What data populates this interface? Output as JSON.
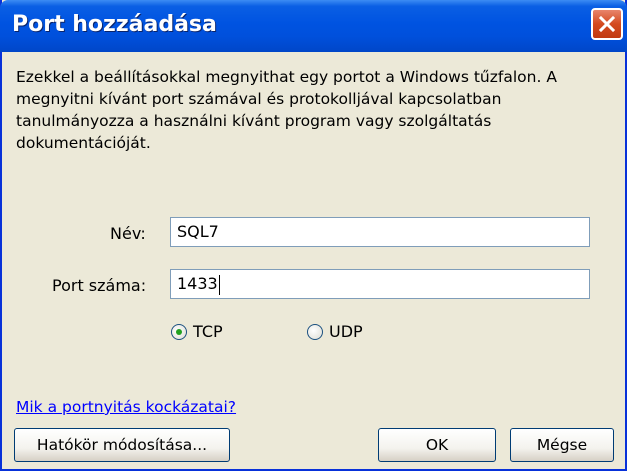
{
  "window": {
    "title": "Port hozzáadása"
  },
  "description": "Ezekkel a beállításokkal megnyithat egy portot a Windows tűzfalon. A megnyitni kívánt port számával és protokolljával kapcsolatban tanulmányozza a használni kívánt program vagy szolgáltatás dokumentációját.",
  "fields": {
    "name_label": "Név:",
    "name_value": "SQL7",
    "port_label": "Port száma:",
    "port_value": "1433"
  },
  "protocol": {
    "tcp_label": "TCP",
    "udp_label": "UDP",
    "selected": "TCP"
  },
  "link": {
    "risks": "Mik a portnyitás kockázatai?"
  },
  "buttons": {
    "scope": "Hatókör módosítása...",
    "ok": "OK",
    "cancel": "Mégse"
  },
  "icons": {
    "close": "close-icon",
    "radio_selected": "radio-selected-icon",
    "radio_unselected": "radio-unselected-icon"
  }
}
